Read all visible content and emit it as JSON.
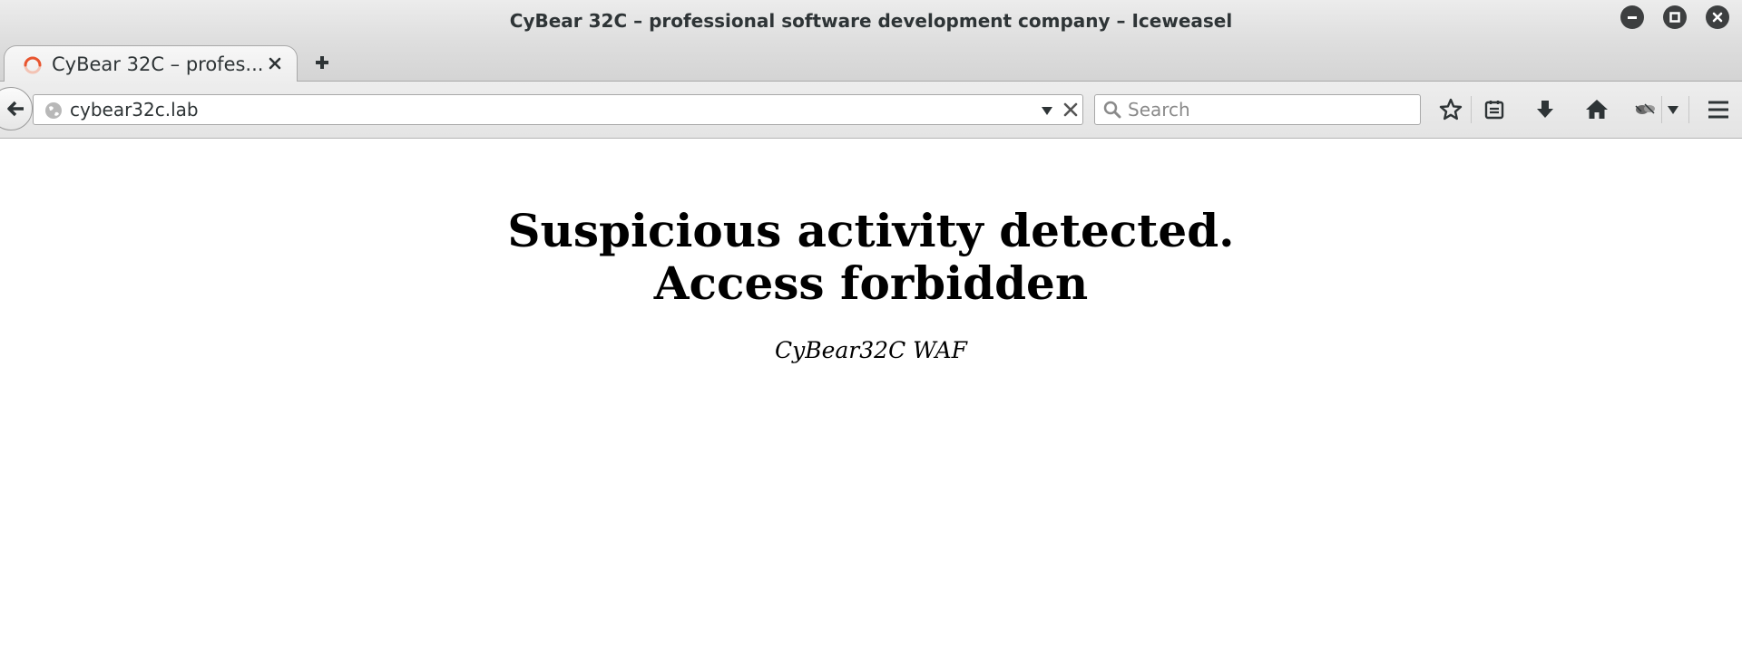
{
  "window": {
    "title": "CyBear 32C – professional software development company – Iceweasel"
  },
  "tabs": [
    {
      "label": "CyBear 32C – profes...",
      "favicon": "loading-throbber-icon"
    }
  ],
  "toolbar": {
    "url": "cybear32c.lab",
    "search_placeholder": "Search",
    "icons": [
      "back-arrow-icon",
      "globe-icon",
      "dropdown-arrow-icon",
      "clear-x-icon",
      "search-icon",
      "bookmark-star-icon",
      "reading-list-icon",
      "download-arrow-icon",
      "home-icon",
      "extension-icon",
      "menu-dropdown-icon",
      "hamburger-menu-icon"
    ]
  },
  "page": {
    "heading_line1": "Suspicious activity detected.",
    "heading_line2": "Access forbidden",
    "subtitle": "CyBear32C WAF"
  },
  "colors": {
    "window_chrome": "#dedede",
    "window_buttons": "#3d3f40",
    "throbber": "#e8552f",
    "text": "#000000"
  }
}
